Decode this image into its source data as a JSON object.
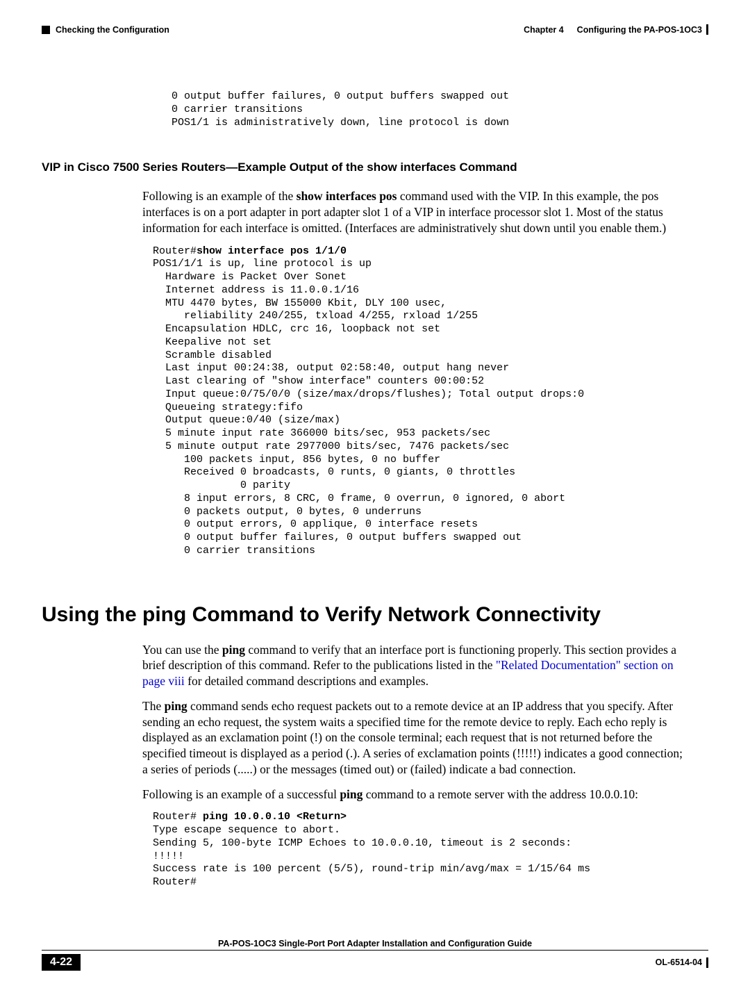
{
  "header": {
    "left_text": "Checking the Configuration",
    "chapter_label": "Chapter 4",
    "chapter_title": "Configuring the PA-POS-1OC3"
  },
  "code1": "   0 output buffer failures, 0 output buffers swapped out\n   0 carrier transitions\n   POS1/1 is administratively down, line protocol is down",
  "sect1": {
    "heading": "VIP in Cisco 7500 Series Routers—Example Output of the show interfaces Command",
    "para_pre": "Following is an example of the ",
    "para_bold": "show interfaces pos",
    "para_post": " command used with the VIP. In this example, the pos interfaces is on a port adapter in port adapter slot 1 of a VIP in interface processor slot 1. Most of the status information for each interface is omitted. (Interfaces are administratively shut down until you enable them.)",
    "cmd_prompt": "Router#",
    "cmd_bold": "show interface pos 1/1/0",
    "output": "POS1/1/1 is up, line protocol is up\n  Hardware is Packet Over Sonet\n  Internet address is 11.0.0.1/16\n  MTU 4470 bytes, BW 155000 Kbit, DLY 100 usec,\n     reliability 240/255, txload 4/255, rxload 1/255\n  Encapsulation HDLC, crc 16, loopback not set\n  Keepalive not set\n  Scramble disabled\n  Last input 00:24:38, output 02:58:40, output hang never\n  Last clearing of \"show interface\" counters 00:00:52\n  Input queue:0/75/0/0 (size/max/drops/flushes); Total output drops:0\n  Queueing strategy:fifo\n  Output queue:0/40 (size/max)\n  5 minute input rate 366000 bits/sec, 953 packets/sec\n  5 minute output rate 2977000 bits/sec, 7476 packets/sec\n     100 packets input, 856 bytes, 0 no buffer\n     Received 0 broadcasts, 0 runts, 0 giants, 0 throttles\n              0 parity\n     8 input errors, 8 CRC, 0 frame, 0 overrun, 0 ignored, 0 abort\n     0 packets output, 0 bytes, 0 underruns\n     0 output errors, 0 applique, 0 interface resets\n     0 output buffer failures, 0 output buffers swapped out\n     0 carrier transitions"
  },
  "sect2": {
    "heading": "Using the ping Command to Verify Network Connectivity",
    "p1_pre": "You can use the ",
    "p1_bold": "ping",
    "p1_mid": " command to verify that an interface port is functioning properly. This section provides a brief description of this command. Refer to the publications listed in the ",
    "p1_link": "\"Related Documentation\" section on page viii",
    "p1_post": " for detailed command descriptions and examples.",
    "p2_pre": "The ",
    "p2_bold": "ping",
    "p2_post": " command sends echo request packets out to a remote device at an IP address that you specify. After sending an echo request, the system waits a specified time for the remote device to reply. Each echo reply is displayed as an exclamation point (!) on the console terminal; each request that is not returned before the specified timeout is displayed as a period (.). A series of exclamation points (!!!!!) indicates a good connection; a series of periods (.....) or the messages (timed out) or (failed) indicate a bad connection.",
    "p3_pre": "Following is an example of a successful ",
    "p3_bold": "ping",
    "p3_post": " command to a remote server with the address 10.0.0.10:",
    "cmd_prompt": "Router# ",
    "cmd_bold": "ping 10.0.0.10 <Return>",
    "output": "Type escape sequence to abort.\nSending 5, 100-byte ICMP Echoes to 10.0.0.10, timeout is 2 seconds:\n!!!!!\nSuccess rate is 100 percent (5/5), round-trip min/avg/max = 1/15/64 ms\nRouter#"
  },
  "footer": {
    "title": "PA-POS-1OC3 Single-Port Port Adapter Installation and Configuration Guide",
    "page_number": "4-22",
    "ol": "OL-6514-04"
  }
}
